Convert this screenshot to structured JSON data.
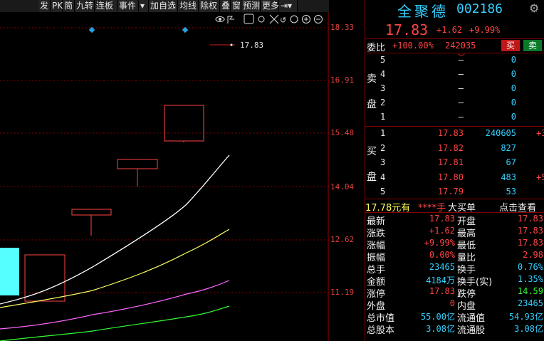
{
  "toolbar": {
    "items": [
      "发",
      "PK",
      "简",
      "九转",
      "连板",
      "事件",
      "加自选",
      "均线",
      "除权",
      "叠",
      "窗",
      "预测",
      "更多"
    ]
  },
  "chart": {
    "price_label": "17.83",
    "y_ticks": [
      "18.33",
      "16.91",
      "15.48",
      "14.04",
      "12.62",
      "11.19"
    ]
  },
  "stock": {
    "name": "全聚德",
    "code": "002186",
    "price": "17.83",
    "change": "+1.62",
    "change_pct": "+9.99%"
  },
  "weibi": {
    "label": "委比",
    "pct": "+100.00%",
    "diff": "242035",
    "sell_btn": "买",
    "buy_btn": "卖"
  },
  "sell_label": [
    "卖",
    "盘"
  ],
  "buy_label": [
    "买",
    "盘"
  ],
  "asks": [
    {
      "lvl": "5",
      "price": "–",
      "vol": "0"
    },
    {
      "lvl": "4",
      "price": "–",
      "vol": "0"
    },
    {
      "lvl": "3",
      "price": "–",
      "vol": "0"
    },
    {
      "lvl": "2",
      "price": "–",
      "vol": "0"
    },
    {
      "lvl": "1",
      "price": "–",
      "vol": "0"
    }
  ],
  "bids": [
    {
      "lvl": "1",
      "price": "17.83",
      "vol": "240605",
      "extra": "+3"
    },
    {
      "lvl": "2",
      "price": "17.82",
      "vol": "827",
      "extra": ""
    },
    {
      "lvl": "3",
      "price": "17.81",
      "vol": "67",
      "extra": ""
    },
    {
      "lvl": "4",
      "price": "17.80",
      "vol": "483",
      "extra": "+5"
    },
    {
      "lvl": "5",
      "price": "17.79",
      "vol": "53",
      "extra": ""
    }
  ],
  "bigorder": {
    "price": "17.78元有",
    "stars": "****手",
    "label": "大买单",
    "link": "点击查看"
  },
  "stats": [
    {
      "l": "最新",
      "v": "17.83",
      "vc": "red",
      "l2": "开盘",
      "v2": "17.83",
      "v2c": "red"
    },
    {
      "l": "涨跌",
      "v": "+1.62",
      "vc": "red",
      "l2": "最高",
      "v2": "17.83",
      "v2c": "red"
    },
    {
      "l": "涨幅",
      "v": "+9.99%",
      "vc": "red",
      "l2": "最低",
      "v2": "17.83",
      "v2c": "red"
    },
    {
      "l": "振幅",
      "v": "0.00%",
      "vc": "red",
      "l2": "量比",
      "v2": "2.98",
      "v2c": "red"
    },
    {
      "l": "总手",
      "v": "23465",
      "vc": "cyan",
      "l2": "换手",
      "v2": "0.76%",
      "v2c": "cyan"
    },
    {
      "l": "金额",
      "v": "4184万",
      "vc": "cyan",
      "l2": "换手(实)",
      "v2": "1.35%",
      "v2c": "cyan"
    },
    {
      "l": "涨停",
      "v": "17.83",
      "vc": "red",
      "l2": "跌停",
      "v2": "14.59",
      "v2c": "green"
    },
    {
      "l": "外盘",
      "v": "0",
      "vc": "red",
      "l2": "内盘",
      "v2": "23465",
      "v2c": "cyan"
    },
    {
      "l": "总市值",
      "v": "55.00亿",
      "vc": "cyan",
      "l2": "流通值",
      "v2": "54.93亿",
      "v2c": "cyan"
    },
    {
      "l": "总股本",
      "v": "3.08亿",
      "vc": "cyan",
      "l2": "流通股",
      "v2": "3.08亿",
      "v2c": "cyan"
    }
  ]
}
